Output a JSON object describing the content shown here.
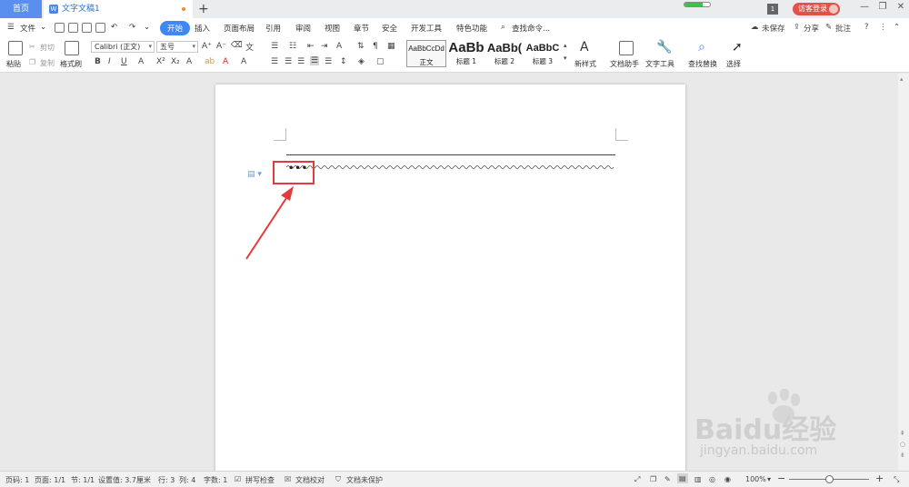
{
  "tabs": {
    "home": "首页",
    "document": "文字文稿1",
    "add": "+",
    "window_count": "1",
    "guest_login": "访客登录"
  },
  "menubar": {
    "file": "文件",
    "items": [
      "开始",
      "插入",
      "页面布局",
      "引用",
      "审阅",
      "视图",
      "章节",
      "安全",
      "开发工具",
      "特色功能"
    ],
    "active": "开始",
    "search_placeholder": "查找命令...",
    "unsaved": "未保存",
    "share": "分享",
    "comment": "批注"
  },
  "ribbon": {
    "paste": "粘贴",
    "cut": "剪切",
    "copy": "复制",
    "format_painter": "格式刷",
    "font_name": "Calibri (正文)",
    "font_size": "五号",
    "bold": "B",
    "italic": "I",
    "underline": "U",
    "styles": [
      {
        "sample": "AaBbCcDd",
        "label": "正文"
      },
      {
        "sample": "AaBb",
        "label": "标题 1"
      },
      {
        "sample": "AaBb(",
        "label": "标题 2"
      },
      {
        "sample": "AaBbC",
        "label": "标题 3"
      }
    ],
    "new_style": "新样式",
    "doc_assistant": "文档助手",
    "text_tools": "文字工具",
    "find_replace": "查找替换",
    "select": "选择"
  },
  "document": {
    "content": "•••"
  },
  "status": {
    "page_num": "页码: 1",
    "pages": "页面: 1/1",
    "section": "节: 1/1",
    "setting": "设置值: 3.7厘米",
    "row": "行: 3",
    "col": "列: 4",
    "word_count": "字数: 1",
    "spell_check": "拼写检查",
    "doc_proof": "文档校对",
    "doc_protect": "文档未保护",
    "zoom": "100%",
    "zoom_level": 0.5
  },
  "watermark": {
    "brand": "Baidu经验",
    "url": "jingyan.baidu.com"
  },
  "colors": {
    "accent": "#3f87f5",
    "annotation": "#e23b3b",
    "guest": "#e0534a"
  }
}
